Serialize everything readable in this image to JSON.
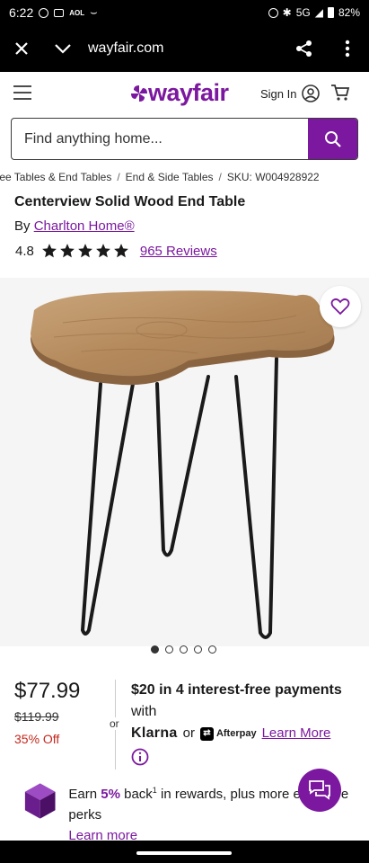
{
  "status_bar": {
    "time": "6:22",
    "aol": "AOL",
    "network": "5G",
    "battery": "82%"
  },
  "browser": {
    "url": "wayfair.com"
  },
  "header": {
    "logo": "wayfair",
    "sign_in": "Sign In"
  },
  "search": {
    "placeholder": "Find anything home..."
  },
  "breadcrumbs": [
    "fee Tables & End Tables",
    "End & Side Tables",
    "SKU: W004928922"
  ],
  "product": {
    "title": "Centerview Solid Wood End Table",
    "by_label": "By",
    "brand": "Charlton Home®",
    "rating": "4.8",
    "rating_value": 4.8,
    "stars": 5,
    "reviews": "965 Reviews"
  },
  "gallery": {
    "image_count": 5,
    "active_index": 0
  },
  "pricing": {
    "price": "$77.99",
    "original_price": "$119.99",
    "discount": "35% Off",
    "or": "or",
    "installment_amount": "$20",
    "installment_text": "in 4 interest-free payments",
    "with": "with",
    "klarna": "Klarna",
    "or2": "or",
    "afterpay": "Afterpay",
    "learn_more": "Learn More"
  },
  "rewards": {
    "earn": "Earn ",
    "percent": "5%",
    "back": " back",
    "sup": "1",
    "rest": " in rewards, plus more exclusive perks",
    "learn_more": "Learn more"
  },
  "colors": {
    "brand_purple": "#7b189f",
    "discount_red": "#c4271e"
  }
}
